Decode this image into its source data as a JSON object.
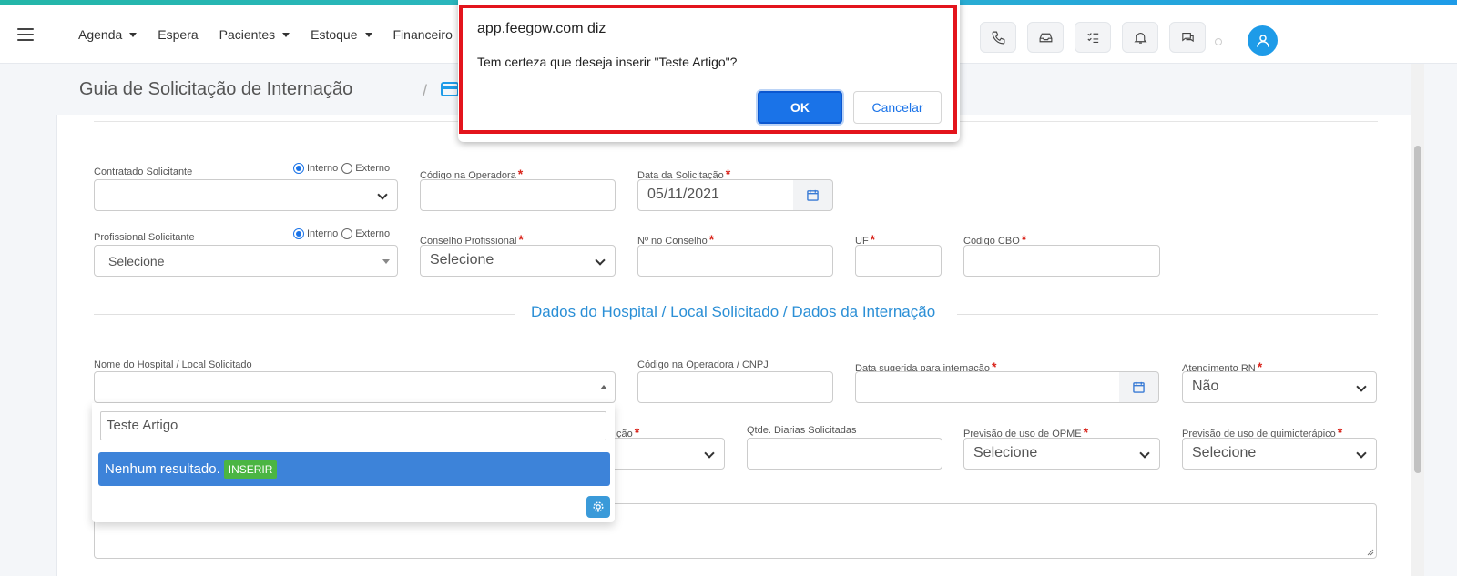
{
  "nav": {
    "items": [
      {
        "label": "Agenda",
        "has_caret": true
      },
      {
        "label": "Espera",
        "has_caret": false
      },
      {
        "label": "Pacientes",
        "has_caret": true
      },
      {
        "label": "Estoque",
        "has_caret": true
      },
      {
        "label": "Financeiro",
        "has_caret": false
      }
    ],
    "icons": [
      "phone-icon",
      "inbox-icon",
      "tasks-icon",
      "bell-icon",
      "chat-icon"
    ]
  },
  "header": {
    "title": "Guia de Solicitação de Internação",
    "separator": "/"
  },
  "form": {
    "contratado": {
      "label": "Contratado Solicitante",
      "radio_interno": "Interno",
      "radio_externo": "Externo",
      "selected": "Interno"
    },
    "codigo_operadora": {
      "label": "Código na Operadora",
      "value": ""
    },
    "data_solicitacao": {
      "label": "Data da Solicitação",
      "value": "05/11/2021"
    },
    "profissional": {
      "label": "Profissional Solicitante",
      "radio_interno": "Interno",
      "radio_externo": "Externo",
      "value": "Selecione"
    },
    "conselho": {
      "label": "Conselho Profissional",
      "value": "Selecione"
    },
    "numero_conselho": {
      "label": "Nº no Conselho",
      "value": ""
    },
    "uf": {
      "label": "UF",
      "value": ""
    },
    "cbo": {
      "label": "Código CBO",
      "value": ""
    },
    "section_title": "Dados do Hospital / Local Solicitado / Dados da Internação",
    "hospital": {
      "label": "Nome do Hospital / Local Solicitado",
      "value": ""
    },
    "codigo_cnpj": {
      "label": "Código na Operadora / CNPJ",
      "value": ""
    },
    "data_sugerida": {
      "label": "Data sugerida para internação",
      "value": ""
    },
    "atendimento_rn": {
      "label": "Atendimento RN",
      "value": "Não"
    },
    "partial_label": "ção",
    "qtde_diarias": {
      "label": "Qtde. Diarias Solicitadas",
      "value": ""
    },
    "opme": {
      "label": "Previsão de uso de OPME",
      "value": "Selecione"
    },
    "quimio": {
      "label": "Previsão de uso de quimioterápico",
      "value": "Selecione"
    }
  },
  "dropdown": {
    "search_value": "Teste Artigo",
    "result_text": "Nenhum resultado.",
    "insert_label": "INSERIR"
  },
  "dialog": {
    "title": "app.feegow.com diz",
    "message": "Tem certeza que deseja inserir \"Teste Artigo\"?",
    "ok_label": "OK",
    "cancel_label": "Cancelar"
  },
  "colors": {
    "accent": "#1e9be8",
    "section_title": "#2b8fd6",
    "required": "#d9251c",
    "dialog_ok": "#1a73e8",
    "insert_badge": "#4bb543",
    "dialog_outline": "#e3141c"
  }
}
